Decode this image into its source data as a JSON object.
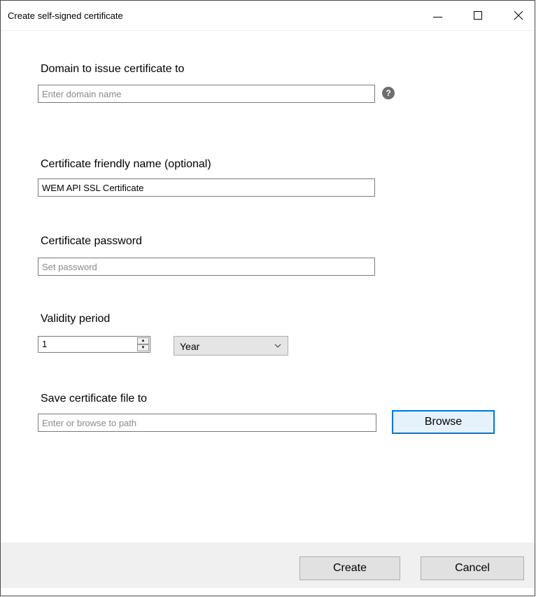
{
  "window": {
    "title": "Create self-signed certificate"
  },
  "form": {
    "domain": {
      "label": "Domain to issue certificate to",
      "placeholder": "Enter domain name",
      "value": "",
      "help_icon_text": "?"
    },
    "friendly_name": {
      "label": "Certificate friendly name (optional)",
      "placeholder": "",
      "value": "WEM API SSL Certificate"
    },
    "password": {
      "label": "Certificate password",
      "placeholder": "Set password",
      "value": ""
    },
    "validity": {
      "label": "Validity period",
      "value": "1",
      "unit": "Year",
      "unit_options_visible": [
        "Year"
      ]
    },
    "save_path": {
      "label": "Save certificate file to",
      "placeholder": "Enter or browse to path",
      "value": "",
      "browse_label": "Browse"
    }
  },
  "footer": {
    "create_label": "Create",
    "cancel_label": "Cancel"
  },
  "icons": {
    "minimize": "minimize-icon",
    "maximize": "maximize-icon",
    "close": "close-icon",
    "help": "help-icon",
    "spin_up": "spin-up-icon",
    "spin_down": "spin-down-icon",
    "dropdown": "chevron-down-icon"
  },
  "colors": {
    "accent": "#0078d7",
    "footer_bg": "#f0f0f0",
    "button_bg": "#e1e1e1",
    "help_icon_bg": "#6d6d6d"
  }
}
